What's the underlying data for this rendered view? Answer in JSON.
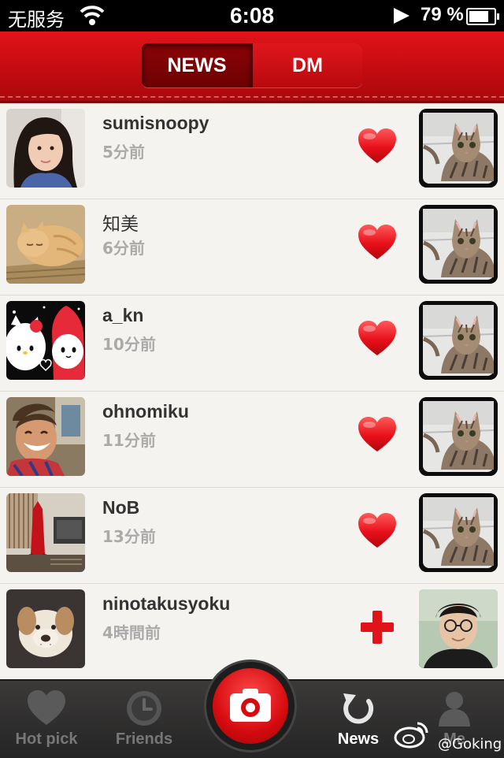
{
  "status_bar": {
    "carrier": "无服务",
    "time": "6:08",
    "battery_percent": "79 %",
    "battery_level": 0.79
  },
  "header": {
    "tabs": [
      {
        "label": "NEWS",
        "selected": true
      },
      {
        "label": "DM",
        "selected": false
      }
    ]
  },
  "news": [
    {
      "user": "sumisnoopy",
      "time": "5分前",
      "action": "heart-icon"
    },
    {
      "user": "知美",
      "time": "6分前",
      "action": "heart-icon"
    },
    {
      "user": "a_kn",
      "time": "10分前",
      "action": "heart-icon"
    },
    {
      "user": "ohnomiku",
      "time": "11分前",
      "action": "heart-icon"
    },
    {
      "user": "NoB",
      "time": "13分前",
      "action": "heart-icon"
    },
    {
      "user": "ninotakusyoku",
      "time": "4時間前",
      "action": "plus-icon"
    }
  ],
  "tab_bar": {
    "items": [
      {
        "label": "Hot pick",
        "icon": "heart-icon"
      },
      {
        "label": "Friends",
        "icon": "clock-icon"
      },
      {
        "label": "News",
        "icon": "refresh-icon",
        "active": true
      },
      {
        "label": "Me",
        "icon": "person-icon"
      }
    ],
    "camera_icon": "camera-icon"
  },
  "watermark": "@Goking",
  "colors": {
    "brand_red": "#c8101a",
    "tab_bar": "#2b2a29",
    "list_bg": "#f4f3ef"
  }
}
